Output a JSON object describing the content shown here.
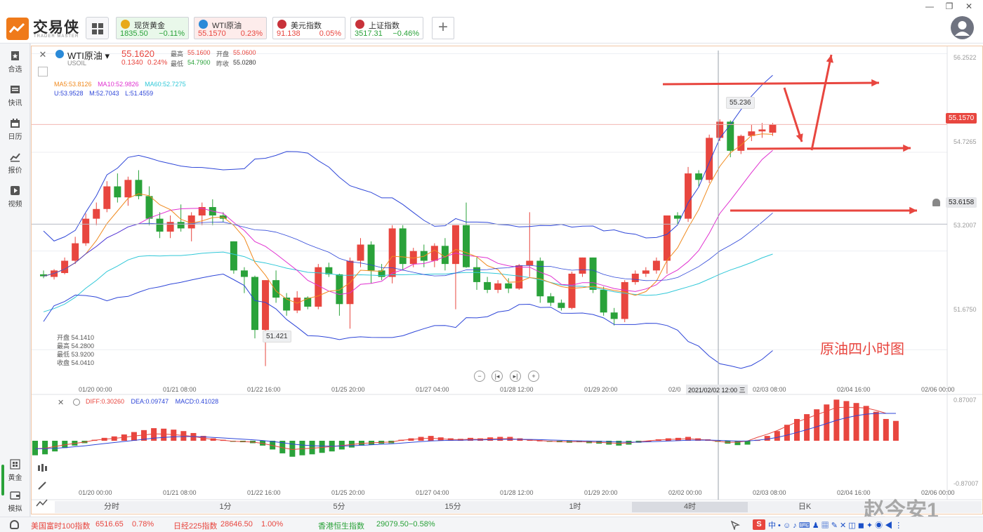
{
  "app": {
    "brand": "交易侠",
    "brand_sub": "TRADER MASTER"
  },
  "watchlist": [
    {
      "name": "现货黄金",
      "price": "1835.50",
      "change": "−0.11%",
      "tone": "green",
      "icon_color": "#e8a91a"
    },
    {
      "name": "WTI原油",
      "price": "55.1570",
      "change": "0.23%",
      "tone": "red",
      "icon_color": "#2a8ad8"
    },
    {
      "name": "美元指数",
      "price": "91.138",
      "change": "0.05%",
      "tone": "red",
      "icon_color": "#c8323a"
    },
    {
      "name": "上证指数",
      "price": "3517.31",
      "change": "−0.46%",
      "tone": "green",
      "icon_color": "#c8323a"
    }
  ],
  "sidebar": [
    {
      "label": "合选",
      "icon": "star-bookmark-icon"
    },
    {
      "label": "快讯",
      "icon": "news-icon"
    },
    {
      "label": "日历",
      "icon": "calendar-icon"
    },
    {
      "label": "报价",
      "icon": "quote-chart-icon"
    },
    {
      "label": "视频",
      "icon": "video-icon"
    },
    {
      "label": "黄金",
      "icon": "gold-icon"
    },
    {
      "label": "模拟",
      "icon": "wallet-icon"
    }
  ],
  "symbol": {
    "name": "WTI原油",
    "code": "USOIL",
    "price": "55.1620",
    "change": "0.1340",
    "change_pct": "0.24%",
    "high_label": "最高",
    "high": "55.1600",
    "open_label": "开盘",
    "open": "55.0600",
    "low_label": "最低",
    "low": "54.7900",
    "prev_label": "昨收",
    "prev": "55.0280"
  },
  "indicators": {
    "ma5": "MA5:53.8126",
    "ma10": "MA10:52.9826",
    "ma60": "MA60:52.7275",
    "boll_u": "U:53.9528",
    "boll_m": "M:52.7043",
    "boll_l": "L:51.4559"
  },
  "ohlc_box": {
    "open": "开盘 54.1410",
    "high": "最高 54.2800",
    "low": "最低 53.9200",
    "close": "收盘 54.0410"
  },
  "price_axis": [
    "56.2522",
    "55.1570",
    "54.7265",
    "53.6158",
    "53.2007",
    "51.6750"
  ],
  "price_tags": {
    "current": "55.1570",
    "alert": "53.6158",
    "peak": "55.236",
    "trough": "51.421"
  },
  "time_axis": [
    "01/20 00:00",
    "01/21 08:00",
    "01/22 16:00",
    "01/25 20:00",
    "01/27 04:00",
    "01/28 12:00",
    "01/29 20:00",
    "02/0",
    "02/03 08:00",
    "02/04 16:00",
    "02/06 00:00"
  ],
  "crosshair_time": "2021/02/02 12:00 三",
  "macd": {
    "diff": "DIFF:0.30260",
    "dea": "DEA:0.09747",
    "macd": "MACD:0.41028",
    "axis_top": "0.87007",
    "axis_bottom": "-0.87007"
  },
  "macd_time_axis": [
    "01/20 00:00",
    "01/21 08:00",
    "01/22 16:00",
    "01/25 20:00",
    "01/27 04:00",
    "01/28 12:00",
    "01/29 20:00",
    "02/02 00:00",
    "02/03 08:00",
    "02/04 16:00",
    "02/06 00:00"
  ],
  "timeframes": [
    "分时",
    "1分",
    "5分",
    "15分",
    "1时",
    "4时",
    "日K"
  ],
  "active_timeframe": "4时",
  "annotation": "原油四小时图",
  "watermark": "赵今安1",
  "status_bar": [
    {
      "name": "美国富时100指数",
      "value": "6516.65",
      "change": "0.78%",
      "tone": "red"
    },
    {
      "name": "日经225指数",
      "value": "28646.50",
      "change": "1.00%",
      "tone": "red"
    },
    {
      "name": "香港恒生指数",
      "value": "29079.50",
      "change": "−0.58%",
      "tone": "green"
    }
  ],
  "colors": {
    "up": "#e8463f",
    "down": "#2aa23a",
    "ma5": "#f08a1e",
    "ma10": "#e030d0",
    "ma60": "#30c8d8",
    "boll": "#2e46d8",
    "accent": "#ef7a1a"
  },
  "chart_data": {
    "type": "candlestick",
    "ylim": [
      51.2,
      56.3
    ],
    "candles": [
      [
        52.84,
        52.9,
        52.78,
        52.81
      ],
      [
        52.8,
        52.92,
        52.76,
        52.9
      ],
      [
        52.86,
        53.1,
        52.84,
        53.05
      ],
      [
        53.05,
        53.42,
        53.0,
        53.32
      ],
      [
        53.32,
        53.78,
        53.28,
        53.7
      ],
      [
        53.7,
        53.95,
        53.6,
        53.85
      ],
      [
        53.85,
        54.28,
        53.8,
        54.2
      ],
      [
        54.2,
        54.4,
        53.95,
        54.03
      ],
      [
        54.03,
        54.35,
        53.9,
        54.3
      ],
      [
        54.3,
        54.45,
        54.0,
        54.05
      ],
      [
        54.05,
        54.2,
        53.6,
        53.7
      ],
      [
        53.7,
        53.8,
        53.4,
        53.5
      ],
      [
        53.5,
        53.75,
        53.4,
        53.65
      ],
      [
        53.65,
        53.92,
        53.5,
        53.55
      ],
      [
        53.55,
        53.8,
        53.35,
        53.75
      ],
      [
        53.75,
        53.95,
        53.6,
        53.88
      ],
      [
        53.88,
        54.0,
        53.6,
        53.75
      ],
      [
        53.75,
        53.8,
        53.65,
        53.7
      ],
      [
        53.35,
        53.35,
        52.85,
        52.9
      ],
      [
        52.9,
        52.95,
        52.55,
        52.8
      ],
      [
        52.8,
        52.82,
        51.85,
        51.98
      ],
      [
        51.98,
        52.75,
        51.421,
        52.75
      ],
      [
        52.75,
        52.9,
        52.4,
        52.48
      ],
      [
        52.48,
        52.55,
        52.2,
        52.28
      ],
      [
        52.28,
        52.58,
        52.24,
        52.48
      ],
      [
        52.48,
        52.5,
        52.3,
        52.34
      ],
      [
        52.34,
        53.0,
        52.3,
        52.95
      ],
      [
        52.95,
        53.02,
        52.8,
        52.84
      ],
      [
        52.84,
        52.85,
        52.2,
        52.38
      ],
      [
        52.38,
        53.1,
        52.0,
        53.05
      ],
      [
        53.05,
        53.4,
        52.95,
        53.3
      ],
      [
        53.3,
        53.35,
        52.7,
        52.9
      ],
      [
        52.9,
        53.0,
        52.75,
        52.8
      ],
      [
        52.8,
        53.6,
        52.7,
        53.55
      ],
      [
        53.55,
        53.6,
        52.9,
        53.0
      ],
      [
        53.0,
        53.25,
        52.95,
        53.2
      ],
      [
        53.2,
        53.3,
        52.95,
        53.05
      ],
      [
        53.05,
        53.32,
        52.95,
        53.28
      ],
      [
        53.28,
        53.4,
        52.9,
        53.0
      ],
      [
        53.0,
        53.45,
        52.3,
        53.6
      ],
      [
        53.6,
        53.95,
        52.94,
        52.95
      ],
      [
        52.95,
        53.1,
        52.6,
        52.72
      ],
      [
        52.72,
        52.8,
        52.55,
        52.6
      ],
      [
        52.6,
        52.75,
        52.55,
        52.7
      ],
      [
        52.7,
        52.78,
        52.55,
        52.62
      ],
      [
        52.62,
        53.0,
        52.6,
        52.98
      ],
      [
        52.98,
        53.8,
        52.8,
        53.05
      ],
      [
        53.05,
        53.1,
        52.4,
        52.5
      ],
      [
        52.5,
        52.55,
        52.35,
        52.4
      ],
      [
        52.4,
        52.45,
        52.28,
        52.32
      ],
      [
        52.32,
        52.88,
        52.3,
        52.85
      ],
      [
        52.85,
        53.1,
        52.8,
        53.1
      ],
      [
        53.1,
        53.1,
        52.55,
        52.6
      ],
      [
        52.6,
        52.65,
        52.2,
        52.25
      ],
      [
        52.25,
        52.32,
        52.05,
        52.15
      ],
      [
        52.15,
        52.75,
        52.1,
        52.72
      ],
      [
        52.72,
        52.9,
        52.68,
        52.85
      ],
      [
        52.85,
        52.95,
        52.8,
        52.9
      ],
      [
        52.9,
        53.1,
        52.85,
        53.05
      ],
      [
        53.05,
        53.75,
        52.85,
        53.75
      ],
      [
        53.75,
        53.8,
        53.6,
        53.7
      ],
      [
        53.7,
        54.5,
        53.65,
        54.4
      ],
      [
        54.4,
        54.45,
        54.2,
        54.3
      ],
      [
        54.3,
        55.0,
        54.25,
        54.95
      ],
      [
        54.95,
        55.236,
        54.9,
        55.2
      ],
      [
        55.2,
        55.22,
        54.65,
        54.75
      ],
      [
        54.75,
        55.0,
        54.7,
        54.98
      ],
      [
        54.98,
        55.15,
        54.9,
        55.05
      ],
      [
        55.05,
        55.18,
        54.95,
        55.08
      ],
      [
        55.03,
        55.18,
        54.98,
        55.16
      ]
    ],
    "macd_hist": [
      -0.3,
      -0.28,
      -0.22,
      -0.15,
      -0.1,
      -0.05,
      0.02,
      0.06,
      0.09,
      0.13,
      0.18,
      0.22,
      0.26,
      0.25,
      0.23,
      0.2,
      0.16,
      0.1,
      0.05,
      0.02,
      -0.02,
      -0.03,
      -0.05,
      -0.1,
      -0.18,
      -0.26,
      -0.33,
      -0.3,
      -0.28,
      -0.25,
      -0.22,
      -0.18,
      -0.14,
      -0.1,
      -0.08,
      -0.06,
      -0.05,
      0.02,
      0.05,
      0.08,
      0.1,
      0.07,
      0.05,
      0.04,
      0.06,
      0.05,
      0.07,
      0.08,
      0.08,
      0.05,
      0.03,
      0.01,
      -0.02,
      -0.03,
      -0.04,
      -0.03,
      -0.05,
      -0.06,
      -0.08,
      -0.1,
      -0.08,
      -0.04,
      0.0,
      0.03,
      0.05,
      0.06,
      0.08,
      0.05,
      0.03,
      -0.02,
      -0.06,
      -0.09,
      -0.08,
      0.02,
      0.1,
      0.2,
      0.33,
      0.45,
      0.55,
      0.65,
      0.75,
      0.85,
      0.82,
      0.78,
      0.72,
      0.6,
      0.45,
      0.41
    ]
  }
}
